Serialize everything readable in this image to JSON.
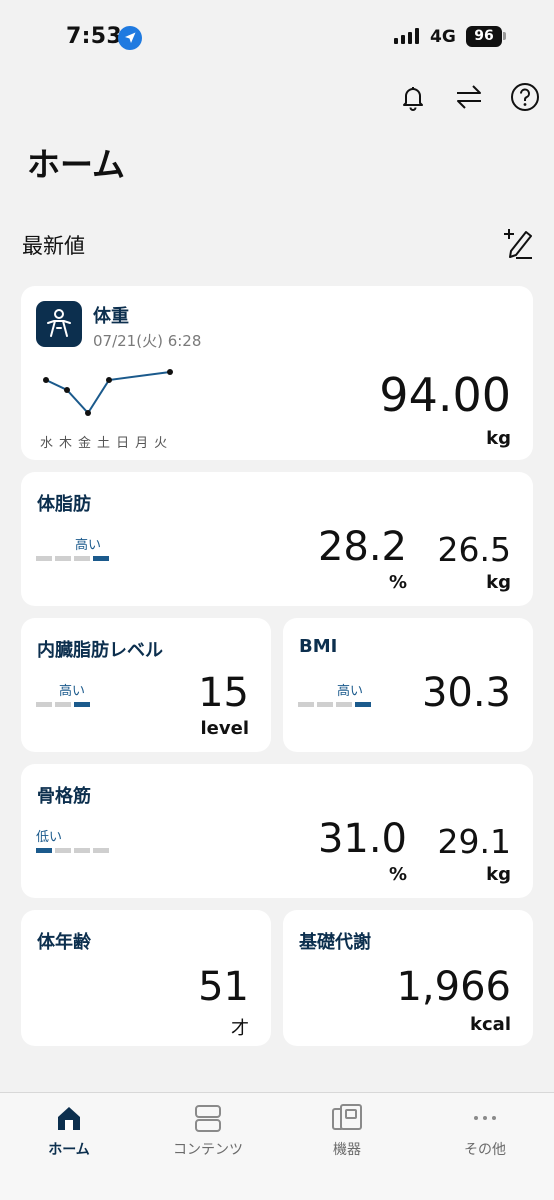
{
  "status": {
    "time": "7:53",
    "network": "4G",
    "battery": "96"
  },
  "header": {
    "title": "ホーム"
  },
  "section": {
    "title": "最新値"
  },
  "weight": {
    "title": "体重",
    "date": "07/21(火) 6:28",
    "value": "94.00",
    "unit": "kg",
    "chart_days": [
      "水",
      "木",
      "金",
      "土",
      "日",
      "月",
      "火"
    ]
  },
  "body_fat": {
    "title": "体脂肪",
    "level_label": "高い",
    "level": 4,
    "percent": "28.2",
    "percent_unit": "%",
    "mass": "26.5",
    "mass_unit": "kg"
  },
  "visceral_fat": {
    "title": "内臓脂肪レベル",
    "level_label": "高い",
    "level": 3,
    "value": "15",
    "unit": "level"
  },
  "bmi": {
    "title": "BMI",
    "level_label": "高い",
    "level": 4,
    "value": "30.3"
  },
  "skeletal_muscle": {
    "title": "骨格筋",
    "level_label": "低い",
    "level": 1,
    "percent": "31.0",
    "percent_unit": "%",
    "mass": "29.1",
    "mass_unit": "kg"
  },
  "body_age": {
    "title": "体年齢",
    "value": "51",
    "unit": "才"
  },
  "bmr": {
    "title": "基礎代謝",
    "value": "1,966",
    "unit": "kcal"
  },
  "nav": {
    "items": [
      {
        "label": "ホーム",
        "icon": "home-icon",
        "active": true
      },
      {
        "label": "コンテンツ",
        "icon": "contents-icon",
        "active": false
      },
      {
        "label": "機器",
        "icon": "devices-icon",
        "active": false
      },
      {
        "label": "その他",
        "icon": "more-icon",
        "active": false
      }
    ]
  },
  "colors": {
    "accent": "#0c2f4e",
    "level_on": "#1b5a8c",
    "level_off": "#cfcfcf",
    "background": "#f2f2f2"
  }
}
